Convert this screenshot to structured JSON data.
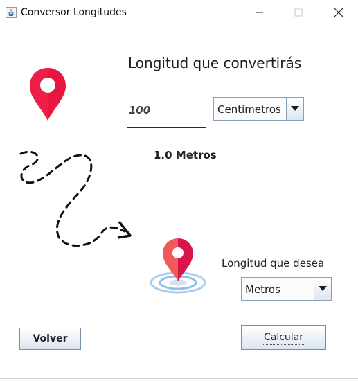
{
  "window": {
    "title": "Conversor Longitudes",
    "controls": {
      "minimize": "minimize-icon",
      "maximize": "maximize-icon",
      "close": "close-icon"
    }
  },
  "form": {
    "main_label": "Longitud que convertirás",
    "input_value": "100",
    "from_unit": "Centimetros",
    "result": "1.0 Metros",
    "target_label": "Longitud que desea",
    "to_unit": "Metros"
  },
  "buttons": {
    "back": "Volver",
    "calculate": "Calcular"
  },
  "colors": {
    "pin_red": "#e8163f",
    "dest_pin_left": "#f25a5a",
    "dest_pin_right": "#d9144d",
    "ripple": "#a9cdee",
    "button_border": "#7a8ea6"
  }
}
